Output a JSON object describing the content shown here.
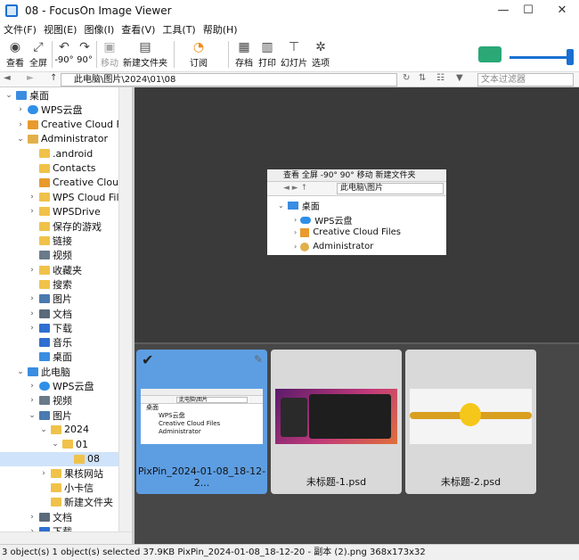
{
  "window": {
    "title": "08 - FocusOn Image Viewer",
    "minimize": "—",
    "maximize": "☐",
    "close": "✕"
  },
  "menu": [
    "文件(F)",
    "视图(E)",
    "图像(I)",
    "查看(V)",
    "工具(T)",
    "帮助(H)"
  ],
  "toolbar": {
    "view": "查看",
    "fullscreen": "全屏",
    "rotate_left": "-90°",
    "rotate_right": "90°",
    "move": "移动",
    "new_folder": "新建文件夹",
    "subscribe": "订阅",
    "save": "存档",
    "print": "打印",
    "slideshow": "幻灯片",
    "options": "选项"
  },
  "address": {
    "path": "此电脑\\图片\\2024\\01\\08",
    "filter_placeholder": "文本过滤器"
  },
  "tree": [
    {
      "label": "桌面",
      "indent": 0,
      "arrow": "open",
      "icon": "desktop"
    },
    {
      "label": "WPS云盘",
      "indent": 1,
      "arrow": "closed",
      "icon": "cloud"
    },
    {
      "label": "Creative Cloud Files",
      "indent": 1,
      "arrow": "closed",
      "icon": "cc"
    },
    {
      "label": "Administrator",
      "indent": 1,
      "arrow": "open",
      "icon": "user"
    },
    {
      "label": ".android",
      "indent": 2,
      "arrow": "",
      "icon": "folder"
    },
    {
      "label": "Contacts",
      "indent": 2,
      "arrow": "",
      "icon": "folder"
    },
    {
      "label": "Creative Cloud Files",
      "indent": 2,
      "arrow": "",
      "icon": "cc"
    },
    {
      "label": "WPS Cloud Files",
      "indent": 2,
      "arrow": "closed",
      "icon": "folder"
    },
    {
      "label": "WPSDrive",
      "indent": 2,
      "arrow": "closed",
      "icon": "folder"
    },
    {
      "label": "保存的游戏",
      "indent": 2,
      "arrow": "",
      "icon": "folder"
    },
    {
      "label": "链接",
      "indent": 2,
      "arrow": "",
      "icon": "folder"
    },
    {
      "label": "视频",
      "indent": 2,
      "arrow": "",
      "icon": "video"
    },
    {
      "label": "收藏夹",
      "indent": 2,
      "arrow": "closed",
      "icon": "folder"
    },
    {
      "label": "搜索",
      "indent": 2,
      "arrow": "",
      "icon": "folder"
    },
    {
      "label": "图片",
      "indent": 2,
      "arrow": "closed",
      "icon": "picture"
    },
    {
      "label": "文档",
      "indent": 2,
      "arrow": "closed",
      "icon": "doc"
    },
    {
      "label": "下载",
      "indent": 2,
      "arrow": "closed",
      "icon": "download"
    },
    {
      "label": "音乐",
      "indent": 2,
      "arrow": "",
      "icon": "music"
    },
    {
      "label": "桌面",
      "indent": 2,
      "arrow": "",
      "icon": "desktop"
    },
    {
      "label": "此电脑",
      "indent": 1,
      "arrow": "open",
      "icon": "pc"
    },
    {
      "label": "WPS云盘",
      "indent": 2,
      "arrow": "closed",
      "icon": "cloud"
    },
    {
      "label": "视频",
      "indent": 2,
      "arrow": "closed",
      "icon": "video"
    },
    {
      "label": "图片",
      "indent": 2,
      "arrow": "open",
      "icon": "picture"
    },
    {
      "label": "2024",
      "indent": 3,
      "arrow": "open",
      "icon": "folder"
    },
    {
      "label": "01",
      "indent": 4,
      "arrow": "open",
      "icon": "folder"
    },
    {
      "label": "08",
      "indent": 5,
      "arrow": "",
      "icon": "folder",
      "selected": true
    },
    {
      "label": "果核网站",
      "indent": 3,
      "arrow": "closed",
      "icon": "folder"
    },
    {
      "label": "小卡信",
      "indent": 3,
      "arrow": "",
      "icon": "folder"
    },
    {
      "label": "新建文件夹",
      "indent": 3,
      "arrow": "",
      "icon": "folder"
    },
    {
      "label": "文档",
      "indent": 2,
      "arrow": "closed",
      "icon": "doc"
    },
    {
      "label": "下载",
      "indent": 2,
      "arrow": "closed",
      "icon": "download"
    }
  ],
  "preview": {
    "toolbar": "查看 全屏  -90° 90°  移动 新建文件夹",
    "path": "此电脑\\图片",
    "items": [
      "桌面",
      "WPS云盘",
      "Creative Cloud Files",
      "Administrator"
    ]
  },
  "thumbs": [
    {
      "name": "PixPin_2024-01-08_18-12-2...",
      "selected": true
    },
    {
      "name": "未标题-1.psd",
      "selected": false
    },
    {
      "name": "未标题-2.psd",
      "selected": false
    }
  ],
  "thumb1": {
    "path": "此电脑\\图片",
    "items": [
      "桌面",
      "WPS云盘",
      "Creative Cloud Files",
      "Administrator"
    ]
  },
  "status": "3 object(s)  1 object(s) selected  37.9KB  PixPin_2024-01-08_18-12-20 - 副本 (2).png  368x173x32",
  "colors": {
    "accent": "#1a6fd1",
    "selection": "#5d9ee3",
    "preview_bg": "#3a3a3a"
  }
}
